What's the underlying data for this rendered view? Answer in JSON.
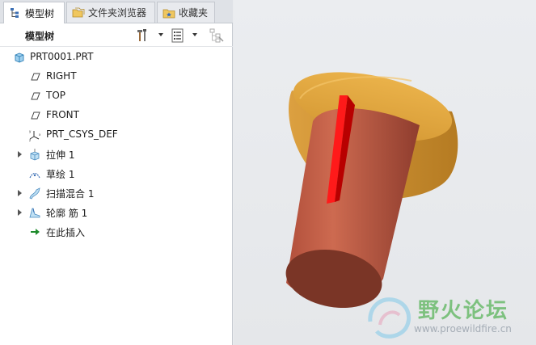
{
  "tabs": [
    {
      "label": "模型树",
      "icon": "model-tree-icon",
      "active": true
    },
    {
      "label": "文件夹浏览器",
      "icon": "folder-browser-icon",
      "active": false
    },
    {
      "label": "收藏夹",
      "icon": "favorites-icon",
      "active": false
    }
  ],
  "tree_toolbar": {
    "title": "模型树",
    "settings_icon": "settings-hammer-icon",
    "show_icon": "show-list-icon",
    "filter_icon": "tree-filter-icon"
  },
  "tree": {
    "root": {
      "label": "PRT0001.PRT",
      "icon": "part-icon"
    },
    "items": [
      {
        "label": "RIGHT",
        "icon": "datum-plane-icon",
        "expandable": false
      },
      {
        "label": "TOP",
        "icon": "datum-plane-icon",
        "expandable": false
      },
      {
        "label": "FRONT",
        "icon": "datum-plane-icon",
        "expandable": false
      },
      {
        "label": "PRT_CSYS_DEF",
        "icon": "coordinate-system-icon",
        "expandable": false
      },
      {
        "label": "拉伸 1",
        "icon": "extrude-icon",
        "expandable": true
      },
      {
        "label": "草绘 1",
        "icon": "sketch-icon",
        "expandable": false
      },
      {
        "label": "扫描混合 1",
        "icon": "swept-blend-icon",
        "expandable": true
      },
      {
        "label": "轮廓 筋 1",
        "icon": "rib-icon",
        "expandable": true
      },
      {
        "label": "在此插入",
        "icon": "insert-here-arrow-icon",
        "expandable": false
      }
    ]
  },
  "watermark": {
    "title": "野火论坛",
    "url": "www.proewildfire.cn"
  },
  "colors": {
    "flange_top": "#e2a63e",
    "flange_side": "#c98d2a",
    "body_light": "#c9624a",
    "body_dark": "#9b4535",
    "end_cap": "#7a3526",
    "rib": "#ff1a1a",
    "rib_dark": "#b80000",
    "watermark_green": "#5bb55b"
  }
}
